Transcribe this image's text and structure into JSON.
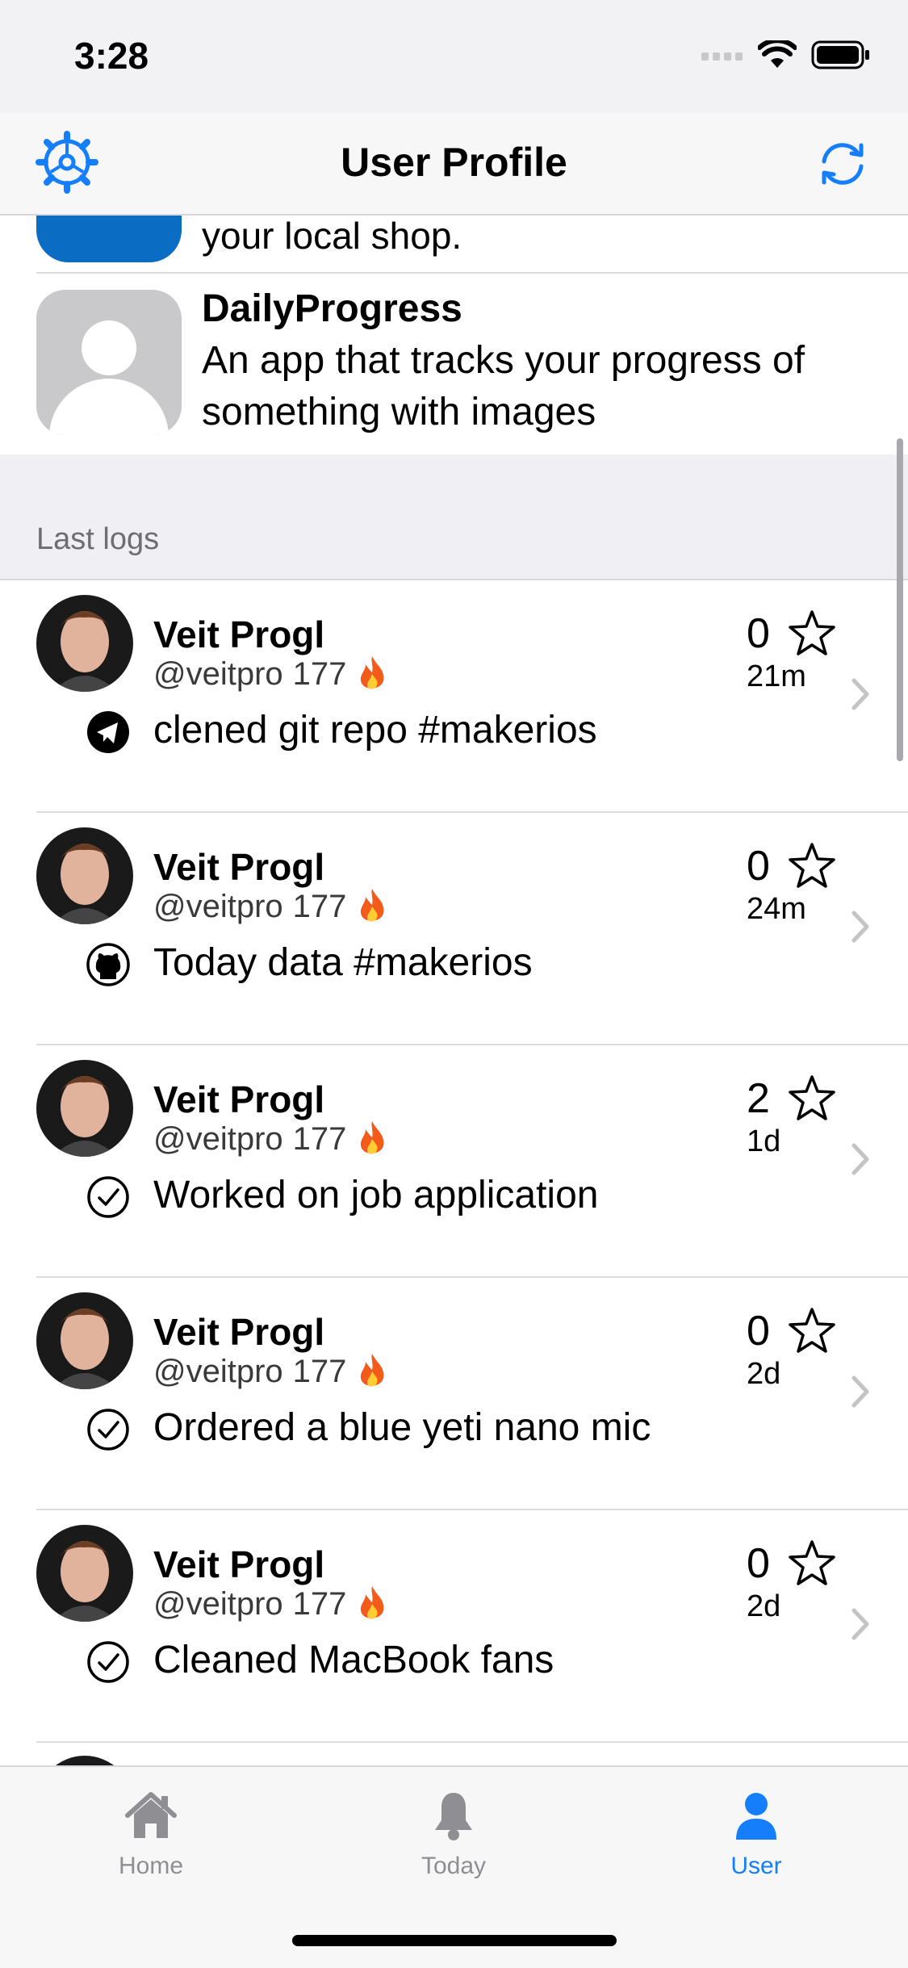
{
  "status_bar": {
    "time": "3:28"
  },
  "nav": {
    "title": "User Profile",
    "left_icon": "gear-icon",
    "right_icon": "refresh-icon"
  },
  "projects": [
    {
      "name": "",
      "description": "your local shop."
    },
    {
      "name": "DailyProgress",
      "description": "An app that tracks your progress of something with images"
    }
  ],
  "section": {
    "title": "Last logs"
  },
  "logs": [
    {
      "name": "Veit Progl",
      "handle": "@veitpro",
      "streak": "177",
      "count": "0",
      "time": "21m",
      "text": "clened git repo #makerios",
      "source": "telegram-icon"
    },
    {
      "name": "Veit Progl",
      "handle": "@veitpro",
      "streak": "177",
      "count": "0",
      "time": "24m",
      "text": "Today data #makerios",
      "source": "github-icon"
    },
    {
      "name": "Veit Progl",
      "handle": "@veitpro",
      "streak": "177",
      "count": "2",
      "time": "1d",
      "text": "Worked on job application",
      "source": "check-circle-icon"
    },
    {
      "name": "Veit Progl",
      "handle": "@veitpro",
      "streak": "177",
      "count": "0",
      "time": "2d",
      "text": "Ordered a blue yeti nano mic",
      "source": "check-circle-icon"
    },
    {
      "name": "Veit Progl",
      "handle": "@veitpro",
      "streak": "177",
      "count": "0",
      "time": "2d",
      "text": "Cleaned MacBook fans",
      "source": "check-circle-icon"
    }
  ],
  "tabs": [
    {
      "label": "Home",
      "icon": "home-icon",
      "active": false
    },
    {
      "label": "Today",
      "icon": "bell-icon",
      "active": false
    },
    {
      "label": "User",
      "icon": "person-icon",
      "active": true
    }
  ],
  "colors": {
    "accent": "#147efb",
    "inactive": "#8e8e93",
    "app_icon": "#0a6cc2"
  }
}
